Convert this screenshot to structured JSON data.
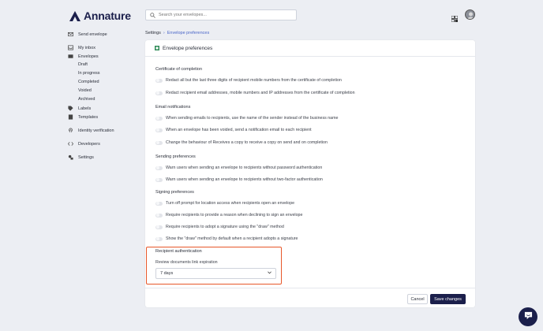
{
  "brand": {
    "name": "Annature",
    "color": "#1b1f4b"
  },
  "search": {
    "placeholder": "Search your envelopes..."
  },
  "sidebar": {
    "items": [
      {
        "label": "Send envelope",
        "icon": "send-icon"
      },
      {
        "label": "My inbox",
        "icon": "inbox-icon"
      },
      {
        "label": "Envelopes",
        "icon": "envelopes-icon"
      },
      {
        "label": "Labels",
        "icon": "tag-icon"
      },
      {
        "label": "Templates",
        "icon": "template-icon"
      },
      {
        "label": "Identity verification",
        "icon": "fingerprint-icon"
      },
      {
        "label": "Developers",
        "icon": "code-icon"
      },
      {
        "label": "Settings",
        "icon": "settings-icon"
      }
    ],
    "envelope_subitems": [
      "Draft",
      "In progress",
      "Completed",
      "Voided",
      "Archived"
    ]
  },
  "breadcrumb": {
    "parent": "Settings",
    "current": "Envelope preferences"
  },
  "card": {
    "title": "Envelope preferences",
    "sections": [
      {
        "title": "Certificate of completion",
        "options": [
          "Redact all but the last three digits of recipient mobile numbers from the certificate of completion",
          "Redact recipient email addresses, mobile numbers and IP addresses from the certificate of completion"
        ]
      },
      {
        "title": "Email notifications",
        "options": [
          "When sending emails to recipients, use the name of the sender instead of the business name",
          "When an envelope has been voided, send a notification email to each recipient",
          "Change the behaviour of Receives a copy to receive a copy on send and on completion"
        ]
      },
      {
        "title": "Sending preferences",
        "options": [
          "Warn users when sending an envelope to recipients without password authentication",
          "Warn users when sending an envelope to recipients without two-factor authentication"
        ]
      },
      {
        "title": "Signing preferences",
        "options": [
          "Turn off prompt for location access when recipients open an envelope",
          "Require recipients to provide a reason when declining to sign an envelope",
          "Require recipients to adopt a signature using the \"draw\" method",
          "Show the \"draw\" method by default when a recipient adopts a signature"
        ]
      }
    ],
    "recipient_auth": {
      "title": "Recipient authentication",
      "label": "Review documents link expiration",
      "selected": "7 days"
    },
    "footer": {
      "cancel_label": "Cancel",
      "save_label": "Save changes"
    }
  },
  "colors": {
    "accent": "#4a66c8",
    "highlight_border": "#e8572a",
    "primary_button": "#1b1f4b"
  }
}
